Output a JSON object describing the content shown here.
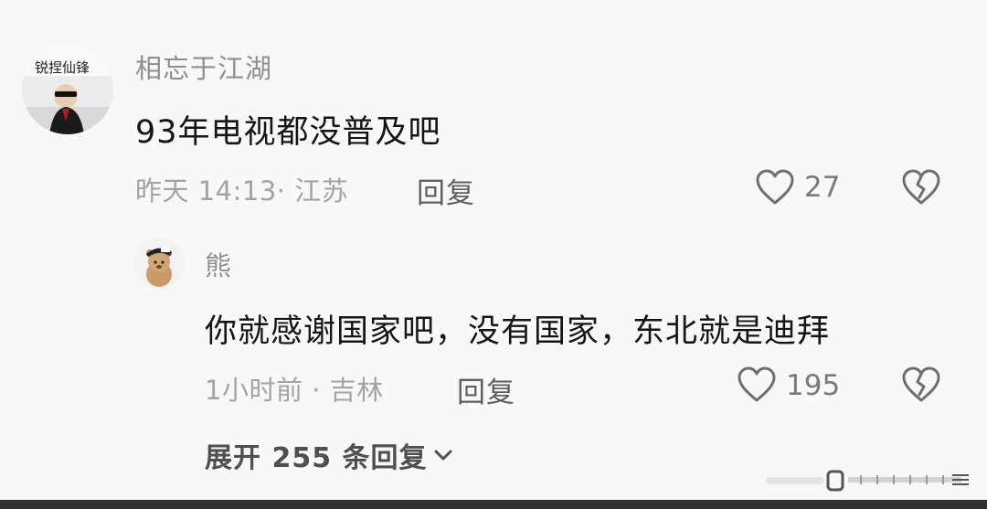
{
  "comment": {
    "username": "相忘于江湖",
    "text": "93年电视都没普及吧",
    "meta": "昨天 14:13· 江苏",
    "reply_label": "回复",
    "likes": "27",
    "avatar_text": "锐捏仙锋"
  },
  "reply": {
    "username": "熊",
    "text": "你就感谢国家吧，没有国家，东北就是迪拜",
    "meta": "1小时前 · 吉林",
    "reply_label": "回复",
    "likes": "195"
  },
  "expand": {
    "label": "展开 255 条回复"
  },
  "icons": {
    "like": "heart-outline-icon",
    "dislike": "broken-heart-icon",
    "expand": "chevron-down-icon"
  }
}
